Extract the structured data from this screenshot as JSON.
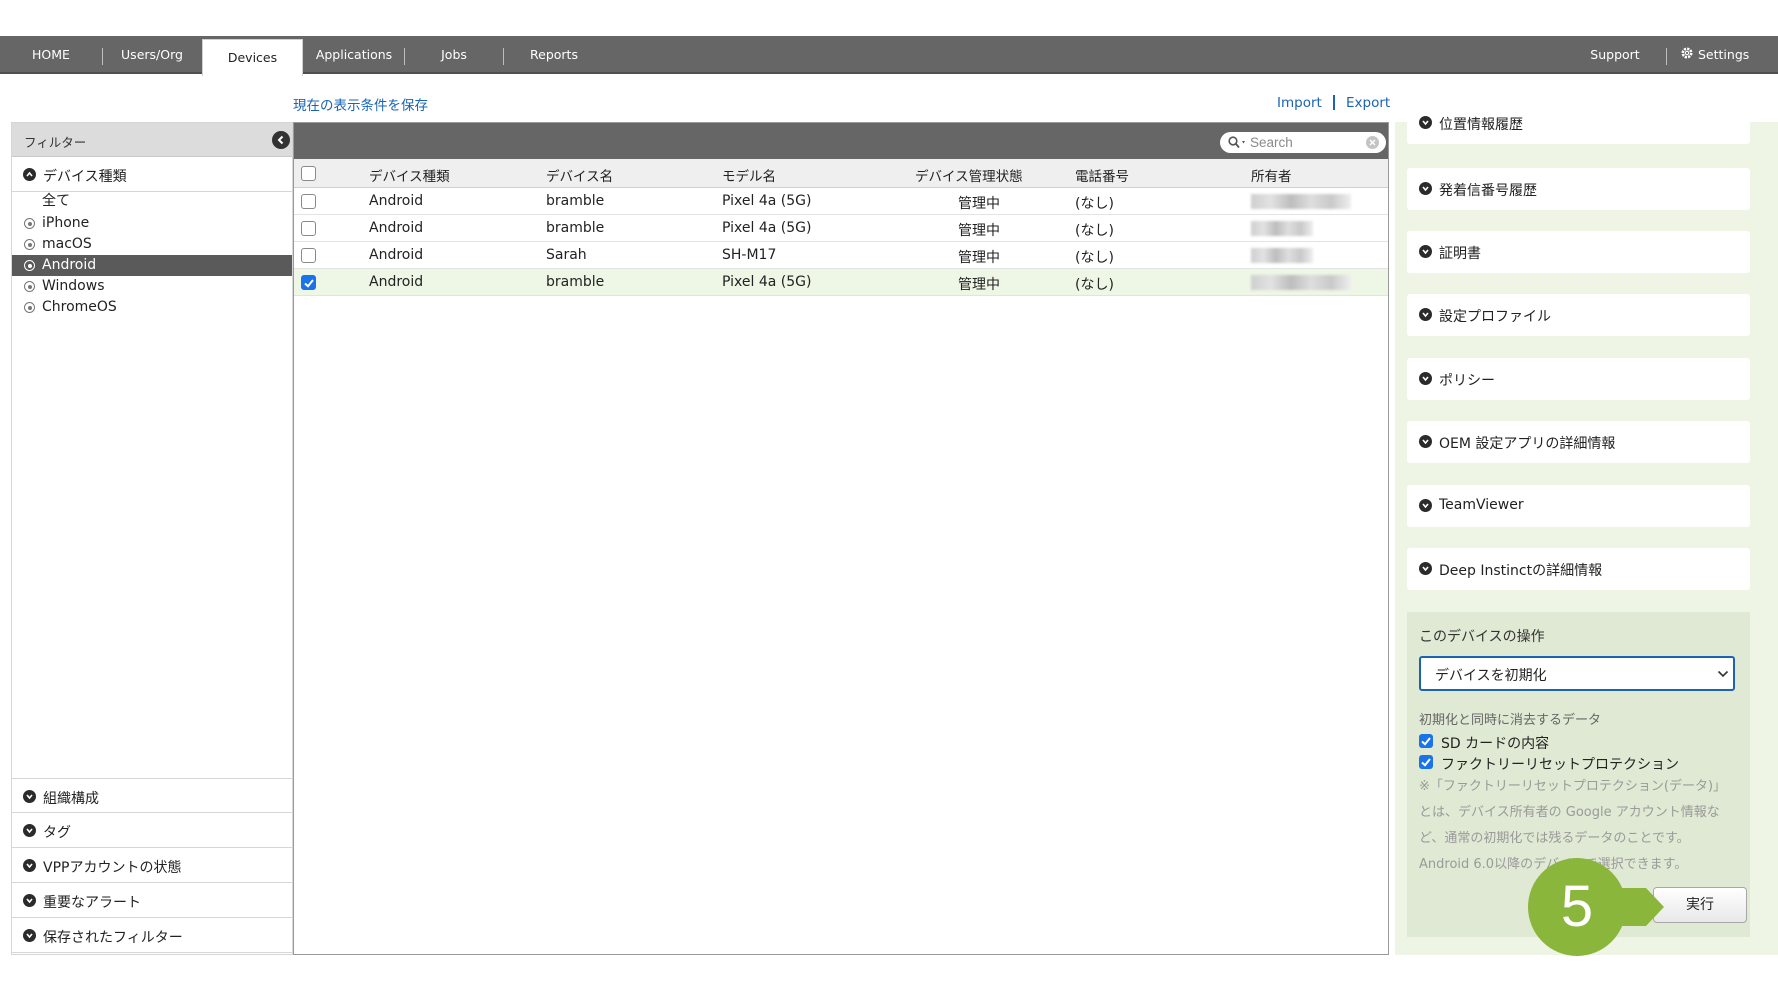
{
  "nav": {
    "tabs": [
      "HOME",
      "Users/Org",
      "Devices",
      "Applications",
      "Jobs",
      "Reports"
    ],
    "active_tab": "Devices",
    "support": "Support",
    "settings": "Settings"
  },
  "subheader": {
    "save_view": "現在の表示条件を保存",
    "import": "Import",
    "export": "Export",
    "separator": "|"
  },
  "filter": {
    "title": "フィルター",
    "device_type_label": "デバイス種類",
    "os_items": [
      "全て",
      "iPhone",
      "macOS",
      "Android",
      "Windows",
      "ChromeOS"
    ],
    "selected_os": "Android",
    "sections": [
      "組織構成",
      "タグ",
      "VPPアカウントの状態",
      "重要なアラート",
      "保存されたフィルター"
    ]
  },
  "table": {
    "search_placeholder": "Search",
    "columns": [
      "デバイス種類",
      "デバイス名",
      "モデル名",
      "デバイス管理状態",
      "電話番号",
      "所有者"
    ],
    "rows": [
      {
        "type": "Android",
        "name": "bramble",
        "model": "Pixel 4a (5G)",
        "status": "管理中",
        "phone": "(なし)",
        "checked": false
      },
      {
        "type": "Android",
        "name": "bramble",
        "model": "Pixel 4a (5G)",
        "status": "管理中",
        "phone": "(なし)",
        "checked": false
      },
      {
        "type": "Android",
        "name": "Sarah",
        "model": "SH-M17",
        "status": "管理中",
        "phone": "(なし)",
        "checked": false
      },
      {
        "type": "Android",
        "name": "bramble",
        "model": "Pixel 4a (5G)",
        "status": "管理中",
        "phone": "(なし)",
        "checked": true
      }
    ]
  },
  "details": {
    "sections": [
      "位置情報履歴",
      "発着信番号履歴",
      "証明書",
      "設定プロファイル",
      "ポリシー",
      "OEM 設定アプリの詳細情報",
      "TeamViewer",
      "Deep Instinctの詳細情報"
    ]
  },
  "operations": {
    "title": "このデバイスの操作",
    "selected_action": "デバイスを初期化",
    "erase_label": "初期化と同時に消去するデータ",
    "options": [
      {
        "label": "SD カードの内容",
        "checked": true
      },
      {
        "label": "ファクトリーリセットプロテクション",
        "checked": true
      }
    ],
    "note": "※「ファクトリーリセットプロテクション(データ)」とは、デバイス所有者の Google アカウント情報など、通常の初期化では残るデータのことです。Android 6.0以降のデバイスで選択できます。",
    "execute": "実行"
  },
  "step": "5"
}
